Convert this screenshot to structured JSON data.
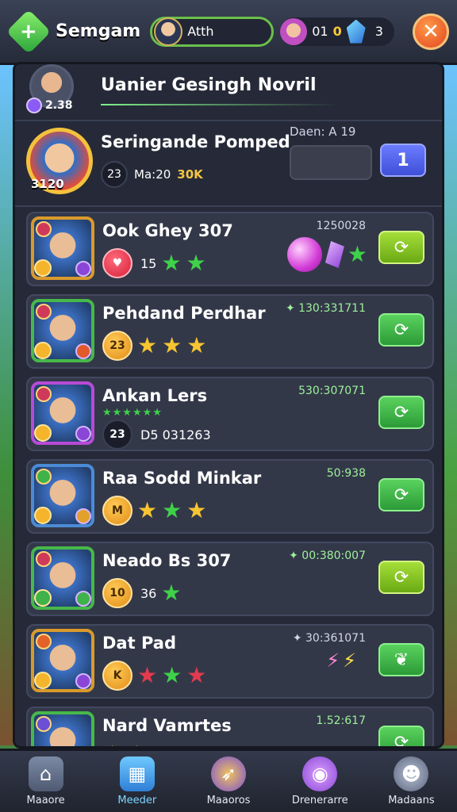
{
  "topbar": {
    "app_title": "Semgam",
    "player_name": "Atth",
    "resource_1": "01",
    "coin_value": "0",
    "gem_value": "3"
  },
  "header": {
    "rank_value": "2.38",
    "title": "Uanier Gesingh Novril"
  },
  "featured": {
    "rank_label": "3120",
    "name": "Seringande Pomped",
    "level": "23",
    "ma_label": "Ma:20",
    "power": "30K",
    "score_label": "Daen: A 19",
    "rank_button": "1"
  },
  "rows": [
    {
      "name": "Ook Ghey 307",
      "score": "1250028",
      "level": "♥",
      "count": "15"
    },
    {
      "name": "Pehdand Perdhar",
      "score": "✦ 130:331711",
      "level": "23"
    },
    {
      "name": "Ankan Lers",
      "score": "530:307071",
      "level": "23",
      "count": "D5 031263"
    },
    {
      "name": "Raa Sodd Minkar",
      "score": "50:938",
      "level": "M"
    },
    {
      "name": "Neado Bs 307",
      "score": "✦ 00:380:007",
      "level": "10",
      "count": "36"
    },
    {
      "name": "Dat Pad",
      "score": "✦ 30:361071",
      "level": "K"
    },
    {
      "name": "Nard Vamrtes",
      "score": "1.52:617"
    }
  ],
  "nav": [
    {
      "label": "Maaore",
      "icon": "home-icon"
    },
    {
      "label": "Meeder",
      "icon": "leaderboard-icon"
    },
    {
      "label": "Maaoros",
      "icon": "compass-icon"
    },
    {
      "label": "Drenerarre",
      "icon": "creature-icon"
    },
    {
      "label": "Madaans",
      "icon": "profile-icon"
    }
  ],
  "colors": {
    "accent_green": "#3fd14a",
    "close_orange": "#e2451e",
    "rank_blue": "#3f4fd8",
    "panel_bg": "#262a38"
  }
}
